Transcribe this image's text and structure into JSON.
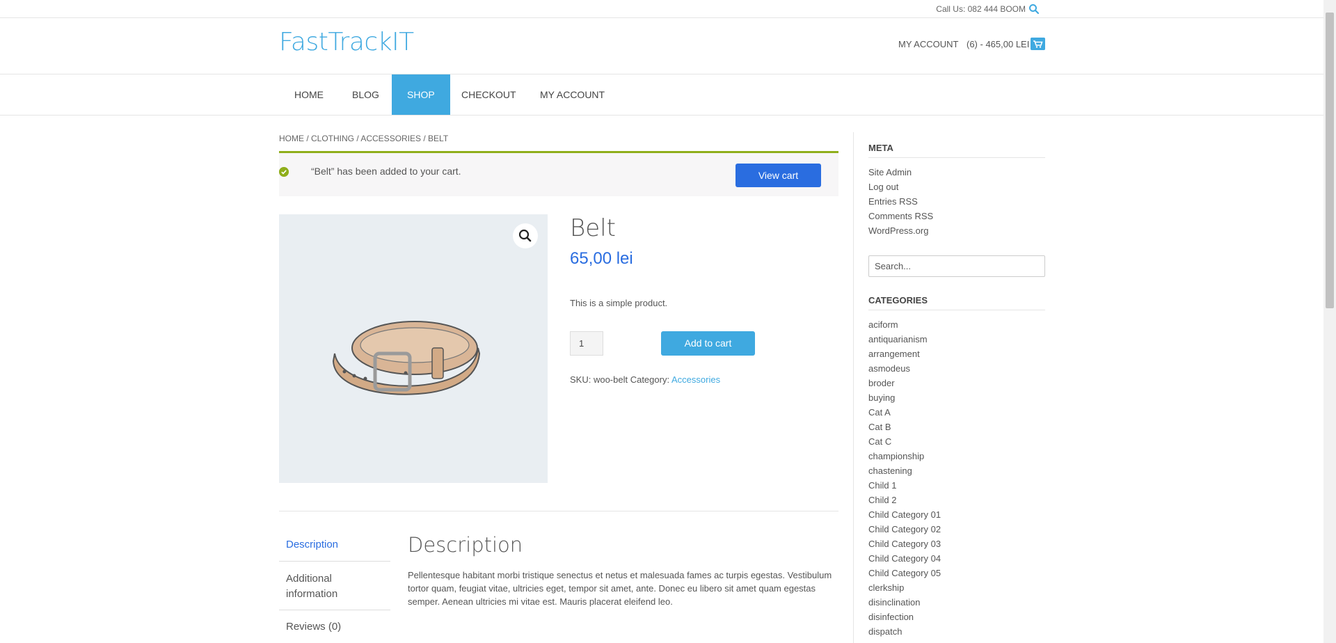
{
  "topbar": {
    "call": "Call Us: 082 444 BOOM"
  },
  "header": {
    "logo": "FastTrackIT",
    "account": "MY ACCOUNT",
    "cart": "(6) - 465,00 LEI"
  },
  "nav": {
    "items": [
      {
        "label": "HOME"
      },
      {
        "label": "BLOG"
      },
      {
        "label": "SHOP"
      },
      {
        "label": "CHECKOUT"
      },
      {
        "label": "MY ACCOUNT"
      }
    ]
  },
  "breadcrumb": "HOME / CLOTHING / ACCESSORIES / BELT",
  "notice": {
    "message": "“Belt” has been added to your cart.",
    "button": "View cart"
  },
  "product": {
    "title": "Belt",
    "price": "65,00 lei",
    "short_desc": "This is a simple product.",
    "quantity": "1",
    "add_to_cart": "Add to cart",
    "sku_label": "SKU: woo-belt Category:",
    "category": "Accessories"
  },
  "tabs": {
    "description": "Description",
    "additional_1": "Additional",
    "additional_2": "information",
    "reviews": "Reviews (0)"
  },
  "description": {
    "title": "Description",
    "body": "Pellentesque habitant morbi tristique senectus et netus et malesuada fames ac turpis egestas. Vestibulum tortor quam, feugiat vitae, ultricies eget, tempor sit amet, ante. Donec eu libero sit amet quam egestas semper. Aenean ultricies mi vitae est. Mauris placerat eleifend leo."
  },
  "sidebar": {
    "meta_title": "META",
    "meta_links": [
      "Site Admin",
      "Log out",
      "Entries RSS",
      "Comments RSS",
      "WordPress.org"
    ],
    "search_placeholder": "Search...",
    "categories_title": "CATEGORIES",
    "categories": [
      "aciform",
      "antiquarianism",
      "arrangement",
      "asmodeus",
      "broder",
      "buying",
      "Cat A",
      "Cat B",
      "Cat C",
      "championship",
      "chastening",
      "Child 1",
      "Child 2",
      "Child Category 01",
      "Child Category 02",
      "Child Category 03",
      "Child Category 04",
      "Child Category 05",
      "clerkship",
      "disinclination",
      "disinfection",
      "dispatch"
    ]
  },
  "colors": {
    "accent": "#3fa9e0",
    "button_blue": "#2a6de0",
    "success": "#8fae1b"
  }
}
